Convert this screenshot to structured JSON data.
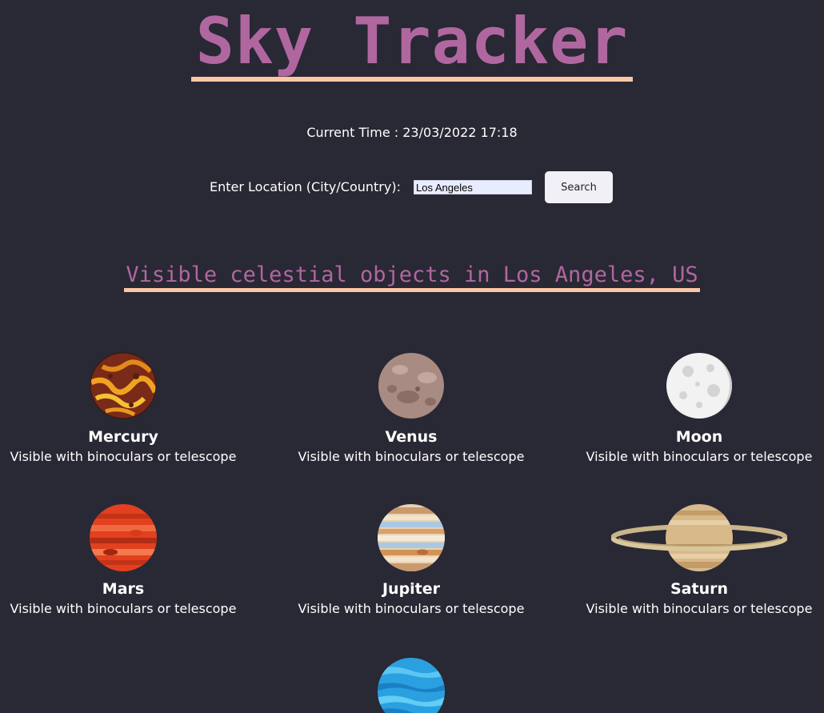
{
  "app": {
    "title": "Sky Tracker",
    "accent_color": "#b0679f",
    "underline_color": "#fdc7a3",
    "background_color": "#292835"
  },
  "time": {
    "text": "Current Time : 23/03/2022 17:18"
  },
  "search": {
    "label": "Enter Location (City/Country):",
    "value": "Los Angeles",
    "button_label": "Search"
  },
  "results": {
    "heading": "Visible celestial objects in Los Angeles, US",
    "objects": [
      {
        "name": "Mercury",
        "visibility": "Visible with binoculars or telescope",
        "icon": "mercury-icon"
      },
      {
        "name": "Venus",
        "visibility": "Visible with binoculars or telescope",
        "icon": "venus-icon"
      },
      {
        "name": "Moon",
        "visibility": "Visible with binoculars or telescope",
        "icon": "moon-icon"
      },
      {
        "name": "Mars",
        "visibility": "Visible with binoculars or telescope",
        "icon": "mars-icon"
      },
      {
        "name": "Jupiter",
        "visibility": "Visible with binoculars or telescope",
        "icon": "jupiter-icon"
      },
      {
        "name": "Saturn",
        "visibility": "Visible with binoculars or telescope",
        "icon": "saturn-icon"
      },
      {
        "name": "",
        "visibility": "",
        "icon": "neptune-icon"
      }
    ]
  }
}
